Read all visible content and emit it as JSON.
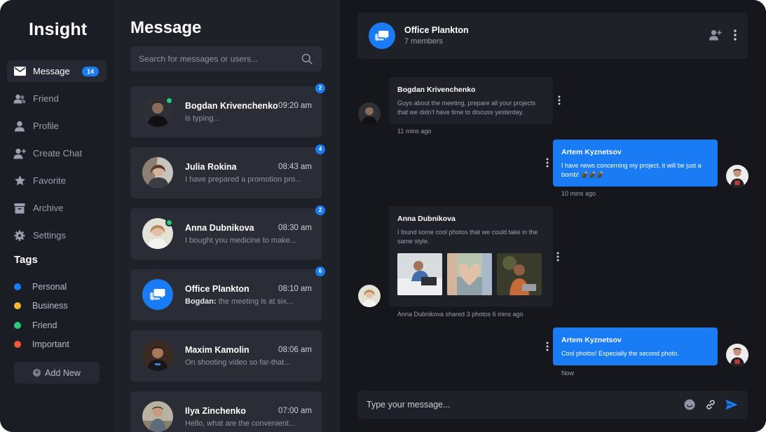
{
  "app": {
    "logo": "Insight"
  },
  "sidebar": {
    "items": [
      {
        "label": "Message",
        "icon": "mail-icon",
        "badge": "14",
        "active": true
      },
      {
        "label": "Friend",
        "icon": "friends-icon"
      },
      {
        "label": "Profile",
        "icon": "user-icon"
      },
      {
        "label": "Create Chat",
        "icon": "add-user-icon"
      },
      {
        "label": "Favorite",
        "icon": "star-icon"
      },
      {
        "label": "Archive",
        "icon": "archive-icon"
      },
      {
        "label": "Settings",
        "icon": "gear-icon"
      }
    ],
    "tags_title": "Tags",
    "tags": [
      {
        "label": "Personal",
        "color": "#1a7cf5"
      },
      {
        "label": "Business",
        "color": "#f5b731"
      },
      {
        "label": "Friend",
        "color": "#2bc779"
      },
      {
        "label": "Important",
        "color": "#f0563b"
      }
    ],
    "add_new": "Add New"
  },
  "messages": {
    "title": "Message",
    "search_placeholder": "Search for messages or users...",
    "conversations": [
      {
        "name": "Bogdan Krivenchenko",
        "time": "09:20 am",
        "preview": "is typing...",
        "unread": "2",
        "online": true,
        "avatar": "photo-avatar"
      },
      {
        "name": "Julia Rokina",
        "time": "08:43 am",
        "preview": "I have prepared a promotion pro...",
        "unread": "4",
        "online": false,
        "avatar": "photo-avatar"
      },
      {
        "name": "Anna Dubnikova",
        "time": "08:30 am",
        "preview": "I bought you medicine to make...",
        "unread": "2",
        "online": true,
        "avatar": "photo-avatar"
      },
      {
        "name": "Office Plankton",
        "time": "08:10 am",
        "preview_sender": "Bogdan:",
        "preview": " the meeting is at six...",
        "unread": "6",
        "online": false,
        "avatar": "group-icon"
      },
      {
        "name": "Maxim Kamolin",
        "time": "08:06 am",
        "preview": "On shooting video so far-that...",
        "online": false,
        "avatar": "photo-avatar"
      },
      {
        "name": "Ilya Zinchenko",
        "time": "07:00 am",
        "preview": "Hello, what are the convenient...",
        "online": false,
        "avatar": "photo-avatar"
      }
    ]
  },
  "chat": {
    "title": "Office Plankton",
    "subtitle": "7 members",
    "header_icons": [
      "add-member-icon",
      "more-vertical-icon"
    ],
    "messages": [
      {
        "author": "Bogdan Krivenchenko",
        "text": "Guys about the meeting, prepare all your projects that we didn't have time to discuss yesterday.",
        "meta": "11 mins ago",
        "direction": "in"
      },
      {
        "author": "Artem Kyznetsov",
        "text": "I have news concerning my project, it will be just a bomb! 💣💣💣",
        "meta": "10 mins ago",
        "direction": "out"
      },
      {
        "author": "Anna Dubnikova",
        "text": "I found some cool photos that we could take in the same style.",
        "meta": "Anna Dubnikova shared 3 photos 6 mins ago",
        "direction": "in",
        "photo_count": 3
      },
      {
        "author": "Artem Kyznetsov",
        "text": "Cool photos! Especially the second photo.",
        "meta": "Now",
        "direction": "out"
      }
    ],
    "composer_placeholder": "Type your message...",
    "composer_icons": [
      "emoji-icon",
      "attach-link-icon",
      "send-icon"
    ]
  },
  "colors": {
    "accent": "#1a7cf5",
    "online": "#2bc779",
    "background": "#15171d",
    "panel": "#1f2128"
  }
}
